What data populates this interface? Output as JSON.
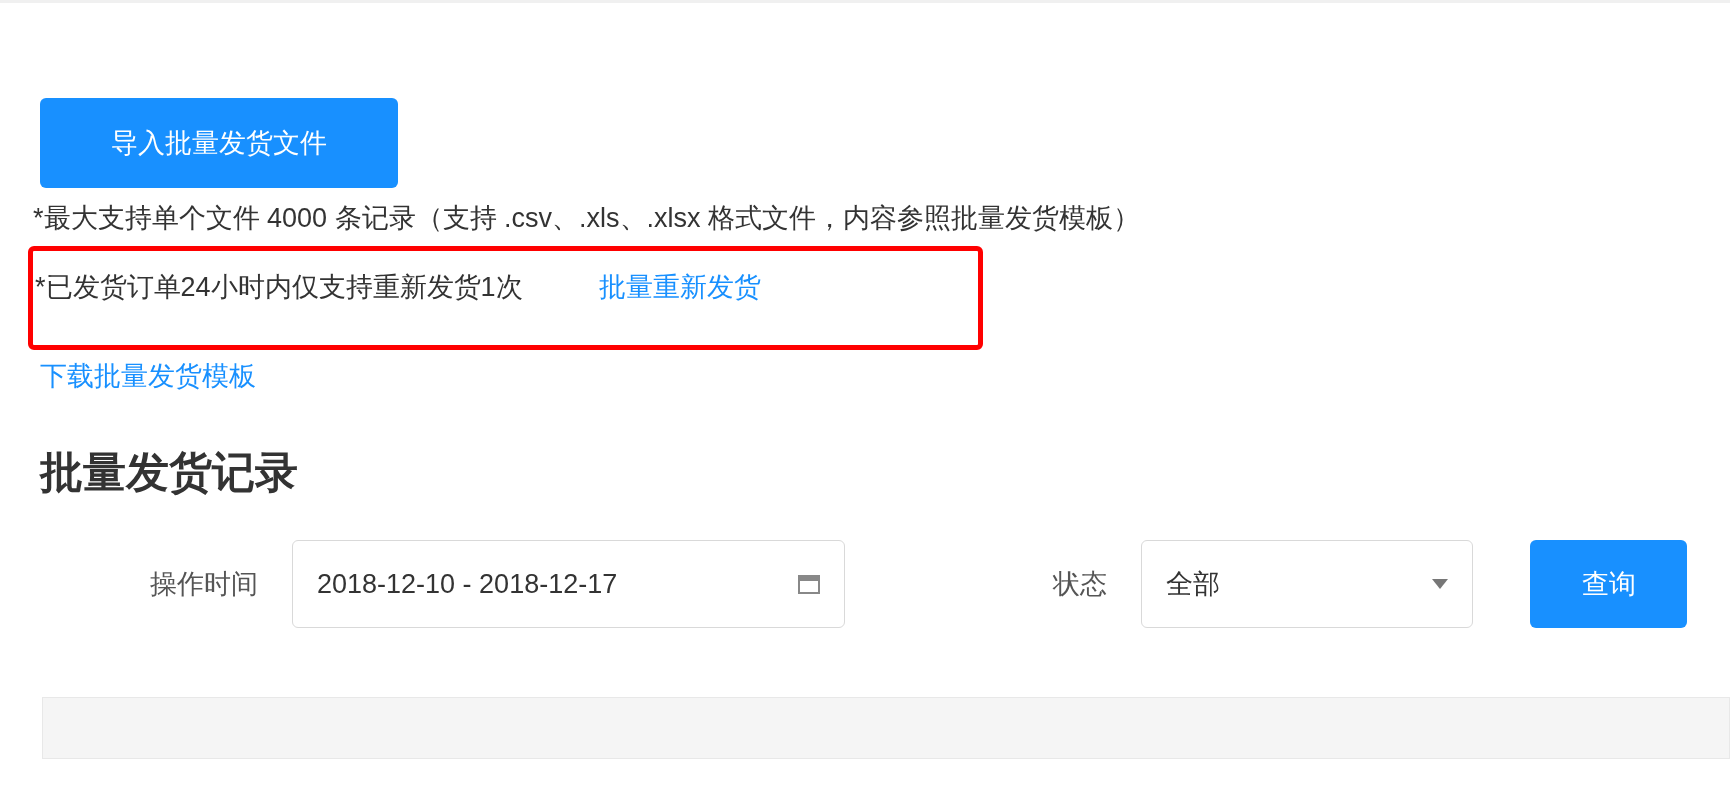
{
  "import_button": {
    "label": "导入批量发货文件"
  },
  "notes": [
    "*最大支持单个文件 4000 条记录（支持 .csv、.xls、.xlsx 格式文件，内容参照批量发货模板）"
  ],
  "highlighted_note": {
    "text": "*已发货订单24小时内仅支持重新发货1次",
    "link": "批量重新发货"
  },
  "template_link": "下载批量发货模板",
  "section_title": "批量发货记录",
  "filters": {
    "date_label": "操作时间",
    "date_value": "2018-12-10 - 2018-12-17",
    "status_label": "状态",
    "status_value": "全部",
    "query_button": "查询"
  }
}
